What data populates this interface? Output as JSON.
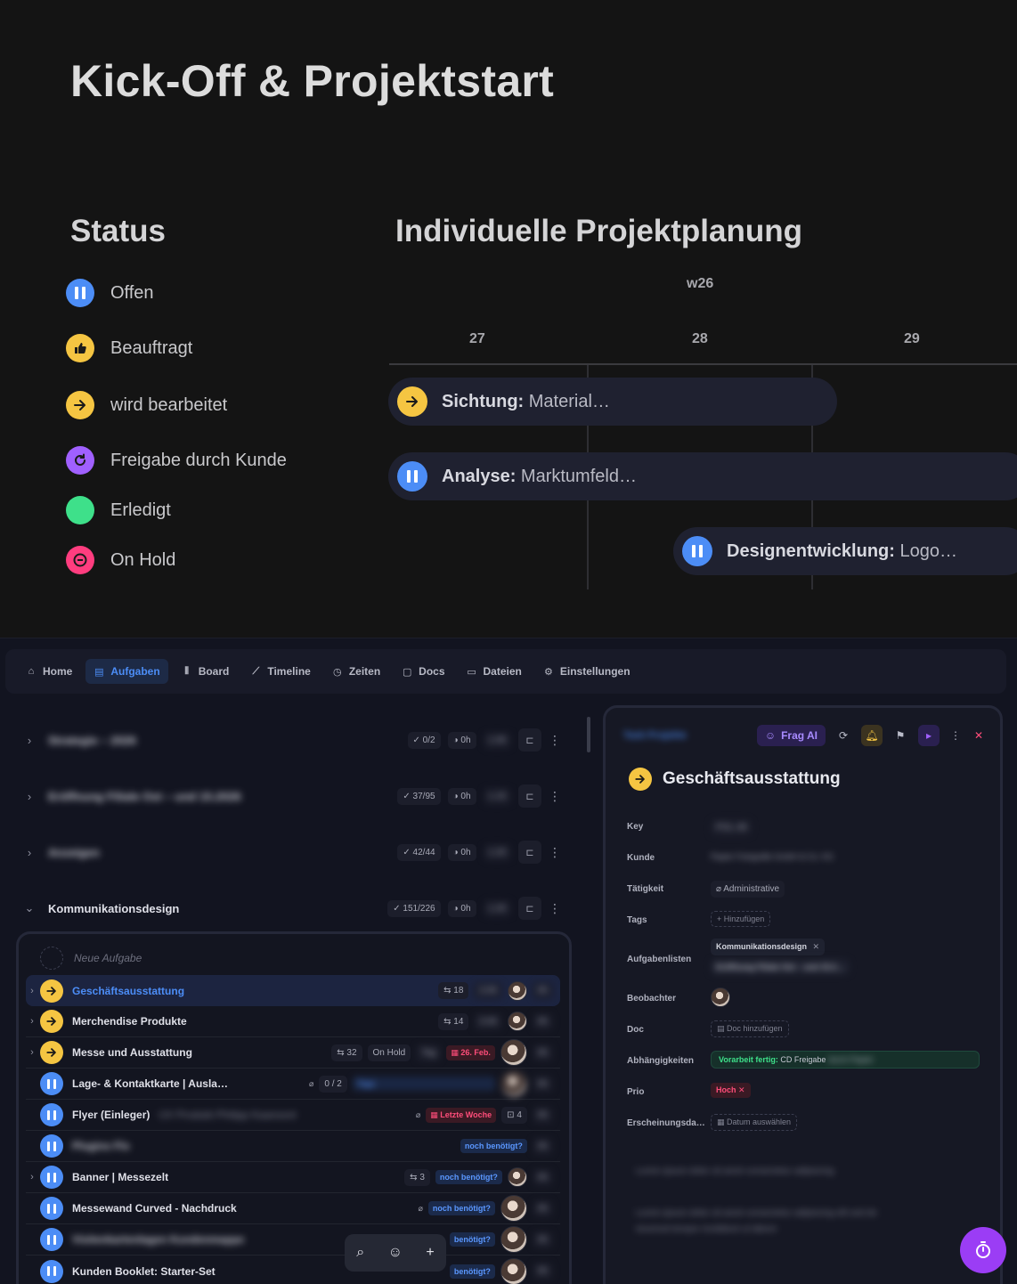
{
  "page_title": "Kick-Off & Projektstart",
  "status_section": {
    "title": "Status",
    "items": [
      {
        "label": "Offen",
        "color": "#4c8df6",
        "icon": "pause-icon"
      },
      {
        "label": "Beauftragt",
        "color": "#f5c542",
        "icon": "thumbs-up-icon"
      },
      {
        "label": "wird bearbeitet",
        "color": "#f5c542",
        "icon": "arrow-right-icon"
      },
      {
        "label": "Freigabe durch Kunde",
        "color": "#a060ff",
        "icon": "refresh-icon"
      },
      {
        "label": "Erledigt",
        "color": "#3ee08a",
        "icon": "check-icon"
      },
      {
        "label": "On Hold",
        "color": "#ff3d7f",
        "icon": "minus-circle-icon"
      }
    ]
  },
  "planning_section": {
    "title": "Individuelle Projektplanung",
    "week": "w26",
    "days": [
      "27",
      "28",
      "29"
    ],
    "bars": [
      {
        "bold": "Sichtung:",
        "text": " Material…",
        "icon": "arrow-right-icon",
        "color": "#f5c542"
      },
      {
        "bold": "Analyse:",
        "text": " Marktumfeld…",
        "icon": "pause-icon",
        "color": "#4c8df6"
      },
      {
        "bold": "Designentwicklung:",
        "text": " Logo…",
        "icon": "pause-icon",
        "color": "#4c8df6"
      }
    ]
  },
  "nav": {
    "items": [
      {
        "label": "Home",
        "icon": "home-icon"
      },
      {
        "label": "Aufgaben",
        "icon": "document-icon",
        "active": true
      },
      {
        "label": "Board",
        "icon": "board-icon"
      },
      {
        "label": "Timeline",
        "icon": "timeline-icon"
      },
      {
        "label": "Zeiten",
        "icon": "clock-icon"
      },
      {
        "label": "Docs",
        "icon": "docs-icon"
      },
      {
        "label": "Dateien",
        "icon": "folder-icon"
      },
      {
        "label": "Einstellungen",
        "icon": "gear-icon"
      }
    ]
  },
  "groups": [
    {
      "name": "Strategie – 2026",
      "progress": "0/2",
      "time": "0h",
      "expanded": false
    },
    {
      "name": "Eröffnung Filiale Ost – und 15.2026",
      "progress": "37/95",
      "time": "0h",
      "expanded": false
    },
    {
      "name": "Anzeigen",
      "progress": "42/44",
      "time": "0h",
      "expanded": false
    },
    {
      "name": "Kommunikationsdesign",
      "progress": "151/226",
      "time": "0h",
      "expanded": true
    }
  ],
  "task_list": {
    "new_task_placeholder": "Neue Aufgabe",
    "tasks": [
      {
        "name": "Geschäftsausstattung",
        "status": "in-progress",
        "subtasks": "18",
        "selected": true
      },
      {
        "name": "Merchendise Produkte",
        "status": "in-progress",
        "subtasks": "14"
      },
      {
        "name": "Messe und Ausstattung",
        "status": "in-progress",
        "subtasks": "32",
        "badge": "On Hold",
        "date": "26. Feb."
      },
      {
        "name": "Lage- & Kontaktkarte | Ausla…",
        "status": "open",
        "count": "0 / 2"
      },
      {
        "name": "Flyer (Einleger)",
        "status": "open",
        "date": "Letzte Woche",
        "comments": "4"
      },
      {
        "name": "Plugins Flo",
        "status": "open",
        "tag": "noch benötigt?"
      },
      {
        "name": "Banner | Messezelt",
        "status": "open",
        "subtasks": "3",
        "tag": "noch benötigt?"
      },
      {
        "name": "Messewand Curved - Nachdruck",
        "status": "open",
        "tag": "noch benötigt?"
      },
      {
        "name": "Visitenkartenlagen Kundenmappe",
        "status": "open",
        "tag": "benötigt?"
      },
      {
        "name": "Kunden Booklet: Starter-Set",
        "status": "open",
        "tag": "benötigt?"
      }
    ]
  },
  "detail": {
    "breadcrumb": "Task Projekte",
    "ask_ai": "Frag AI",
    "title": "Geschäftsausstattung",
    "fields": [
      {
        "label": "Key",
        "value": "POL-48"
      },
      {
        "label": "Kunde",
        "value": "Papier Fotografie GmbH & Co. KG"
      },
      {
        "label": "Tätigkeit",
        "value": "Administrative"
      },
      {
        "label": "Tags",
        "value": "+ Hinzufügen"
      },
      {
        "label": "Aufgabenlisten",
        "value": "Kommunikationsdesign",
        "value2": "Eröffnung Filiale Ost – und 15.2…"
      },
      {
        "label": "Beobachter",
        "value": ""
      },
      {
        "label": "Doc",
        "value": "Doc hinzufügen"
      },
      {
        "label": "Abhängigkeiten",
        "value_bold": "Vorarbeit fertig:",
        "value": " CD Freigabe",
        "value_blur": " durch Papier"
      },
      {
        "label": "Prio",
        "value": "Hoch"
      },
      {
        "label": "Erscheinungsda…",
        "value": "Datum auswählen"
      }
    ],
    "description_lines": [
      "Lorem ipsum dolor sit amet consectetur adipiscing",
      "Lorem ipsum dolor sit amet consectetur adipiscing elit sed do",
      "eiusmod tempor incididunt ut labore"
    ]
  },
  "float_bar": {
    "icons": [
      "search-icon",
      "ai-icon",
      "plus-icon"
    ]
  }
}
